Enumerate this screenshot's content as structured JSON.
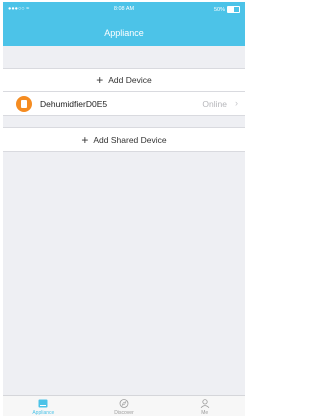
{
  "status_bar": {
    "signal": "●●●○○",
    "wifi_icon": "wifi-icon",
    "time": "8:08 AM",
    "battery": "50%",
    "battery_level": 0.5
  },
  "header": {
    "title": "Appliance"
  },
  "actions": {
    "add_device": "Add Device",
    "add_shared_device": "Add Shared Device"
  },
  "devices": [
    {
      "name": "DehumidfierD0E5",
      "status": "Online",
      "icon": "dehumidifier-icon",
      "icon_color": "#f58c21"
    }
  ],
  "tabs": [
    {
      "label": "Appliance",
      "icon": "appliance-icon",
      "active": true
    },
    {
      "label": "Discover",
      "icon": "compass-icon",
      "active": false
    },
    {
      "label": "Me",
      "icon": "person-icon",
      "active": false
    }
  ],
  "colors": {
    "accent": "#4cc3e8",
    "background": "#eeeff3"
  }
}
